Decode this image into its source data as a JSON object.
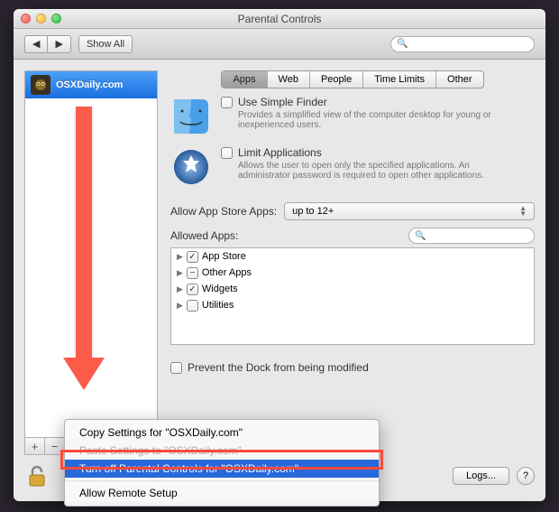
{
  "window": {
    "title": "Parental Controls"
  },
  "toolbar": {
    "back": "◀",
    "forward": "▶",
    "show_all": "Show All",
    "search_placeholder": ""
  },
  "sidebar": {
    "users": [
      {
        "name": "OSXDaily.com"
      }
    ],
    "add": "+",
    "remove": "−",
    "gear": "✻"
  },
  "tabs": {
    "items": [
      {
        "label": "Apps",
        "active": true
      },
      {
        "label": "Web"
      },
      {
        "label": "People"
      },
      {
        "label": "Time Limits"
      },
      {
        "label": "Other"
      }
    ]
  },
  "simple_finder": {
    "title": "Use Simple Finder",
    "desc": "Provides a simplified view of the computer desktop for young or inexperienced users."
  },
  "limit_apps": {
    "title": "Limit Applications",
    "desc": "Allows the user to open only the specified applications. An administrator password is required to open other applications."
  },
  "allow_store": {
    "label": "Allow App Store Apps:",
    "value": "up to 12+"
  },
  "allowed_apps": {
    "label": "Allowed Apps:",
    "search_placeholder": "",
    "items": [
      {
        "name": "App Store",
        "checked": true
      },
      {
        "name": "Other Apps",
        "checked": "mixed"
      },
      {
        "name": "Widgets",
        "checked": true
      },
      {
        "name": "Utilities",
        "checked": false
      }
    ]
  },
  "prevent_dock": {
    "label": "Prevent the Dock from being modified"
  },
  "footer": {
    "logs": "Logs...",
    "help": "?"
  },
  "context_menu": {
    "copy": "Copy Settings for \"OSXDaily.com\"",
    "paste": "Paste Settings to \"OSXDaily.com\"",
    "turn_off": "Turn off Parental Controls for \"OSXDaily.com\"",
    "allow_remote": "Allow Remote Setup"
  }
}
